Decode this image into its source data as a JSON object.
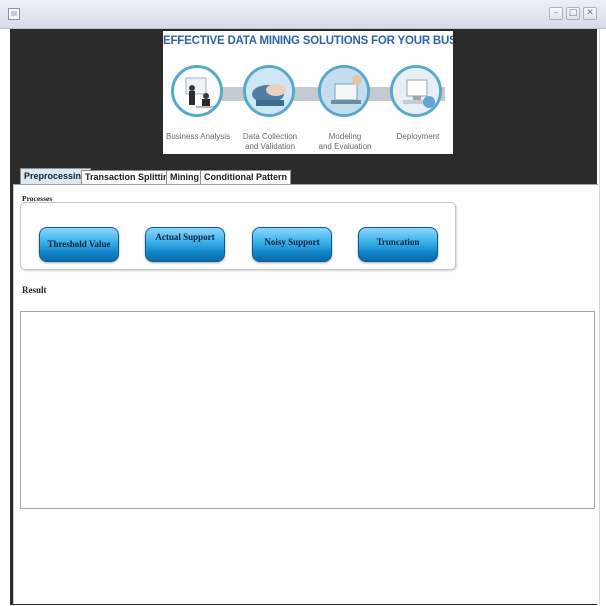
{
  "window": {
    "minimize_glyph": "–",
    "maximize_glyph": "□",
    "close_glyph": "✕"
  },
  "banner": {
    "title": "EFFECTIVE DATA MINING SOLUTIONS FOR YOUR BUSINESS",
    "stages": [
      {
        "label": "Business Analysis"
      },
      {
        "label": "Data Collection\nand Validation"
      },
      {
        "label": "Modeling\nand Evaluation"
      },
      {
        "label": "Deployment"
      }
    ]
  },
  "tabs": [
    {
      "label": "Preprocessing",
      "active": true
    },
    {
      "label": "Transaction Splitting",
      "active": false
    },
    {
      "label": "Mining",
      "active": false
    },
    {
      "label": "Conditional Pattern",
      "active": false
    }
  ],
  "processes": {
    "label": "Processes",
    "buttons": [
      {
        "label": "Threshold Value"
      },
      {
        "label": "Actual Support"
      },
      {
        "label": "Noisy Support"
      },
      {
        "label": "Truncation"
      }
    ]
  },
  "result": {
    "label": "Result",
    "value": ""
  },
  "colors": {
    "banner_title": "#2f63ad",
    "button_blue": "#1f95d6",
    "background_dark": "#2b2b2b",
    "active_tab": "#dbe9f6"
  }
}
